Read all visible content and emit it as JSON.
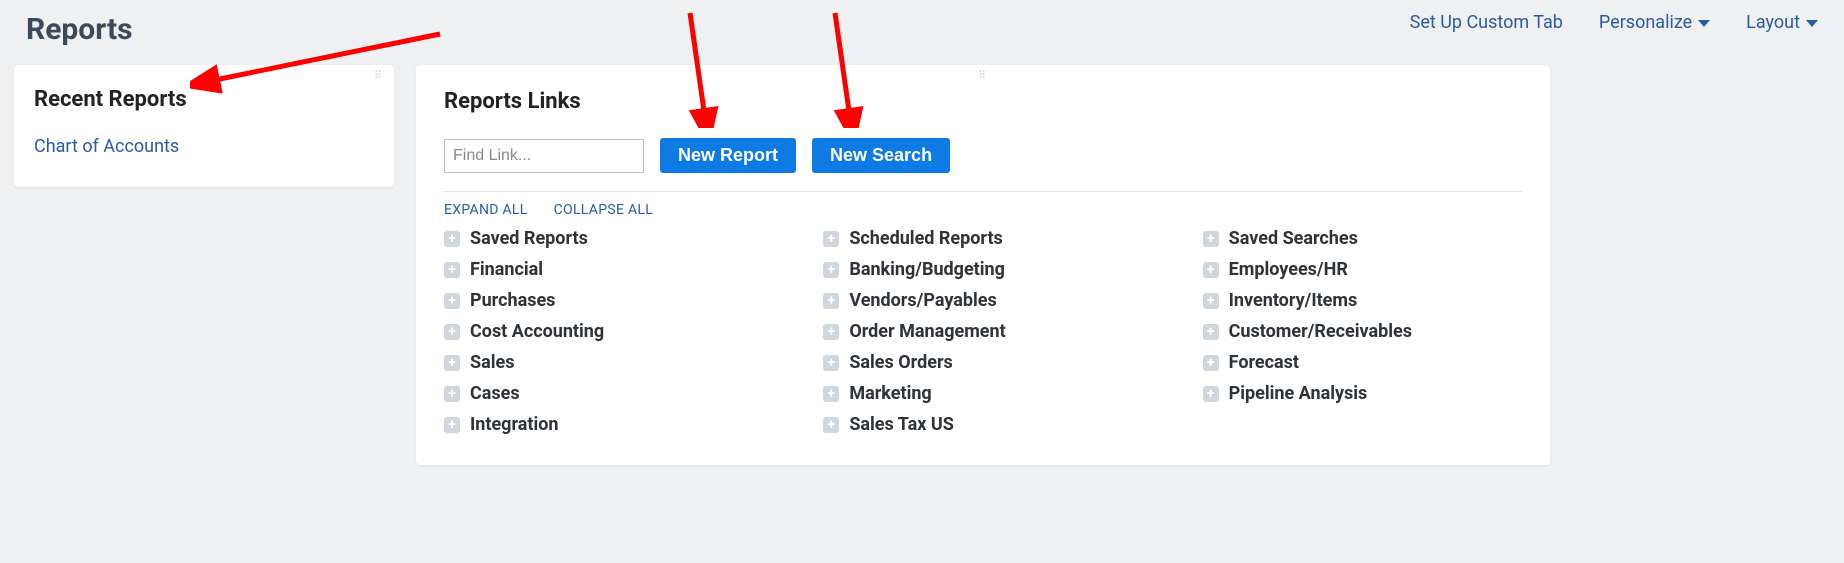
{
  "header": {
    "title": "Reports",
    "actions": {
      "setup": "Set Up Custom Tab",
      "personalize": "Personalize",
      "layout": "Layout"
    }
  },
  "sidebar": {
    "title": "Recent Reports",
    "items": [
      "Chart of Accounts"
    ]
  },
  "main": {
    "title": "Reports Links",
    "find_placeholder": "Find Link...",
    "new_report": "New Report",
    "new_search": "New Search",
    "expand_all": "EXPAND ALL",
    "collapse_all": "COLLAPSE ALL",
    "columns": [
      [
        "Saved Reports",
        "Financial",
        "Purchases",
        "Cost Accounting",
        "Sales",
        "Cases",
        "Integration"
      ],
      [
        "Scheduled Reports",
        "Banking/Budgeting",
        "Vendors/Payables",
        "Order Management",
        "Sales Orders",
        "Marketing",
        "Sales Tax US"
      ],
      [
        "Saved Searches",
        "Employees/HR",
        "Inventory/Items",
        "Customer/Receivables",
        "Forecast",
        "Pipeline Analysis"
      ]
    ]
  }
}
